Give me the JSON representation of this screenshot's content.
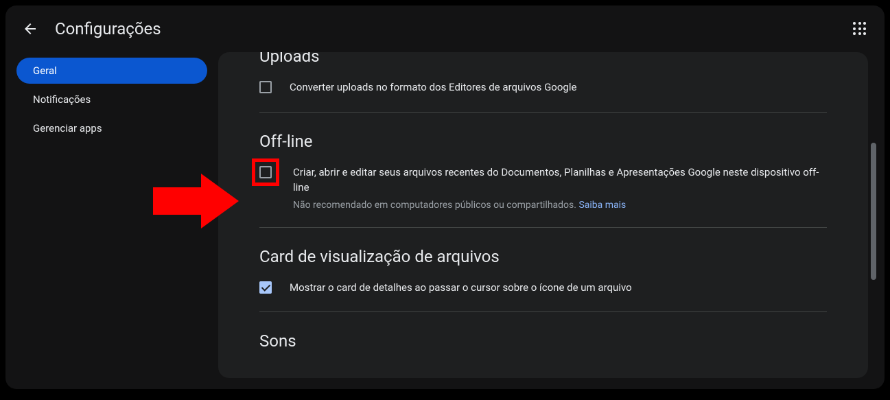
{
  "header": {
    "title": "Configurações"
  },
  "sidebar": {
    "items": [
      {
        "label": "Geral",
        "active": true
      },
      {
        "label": "Notificações",
        "active": false
      },
      {
        "label": "Gerenciar apps",
        "active": false
      }
    ]
  },
  "sections": {
    "uploads": {
      "title": "Uploads",
      "checkbox_label": "Converter uploads no formato dos Editores de arquivos Google"
    },
    "offline": {
      "title": "Off-line",
      "checkbox_label": "Criar, abrir e editar seus arquivos recentes do Documentos, Planilhas e Apresentações Google neste dispositivo off-line",
      "sub_text": "Não recomendado em computadores públicos ou compartilhados. ",
      "link_text": "Saiba mais"
    },
    "card": {
      "title": "Card de visualização de arquivos",
      "checkbox_label": "Mostrar o card de detalhes ao passar o cursor sobre o ícone de um arquivo"
    },
    "sounds": {
      "title": "Sons"
    }
  }
}
